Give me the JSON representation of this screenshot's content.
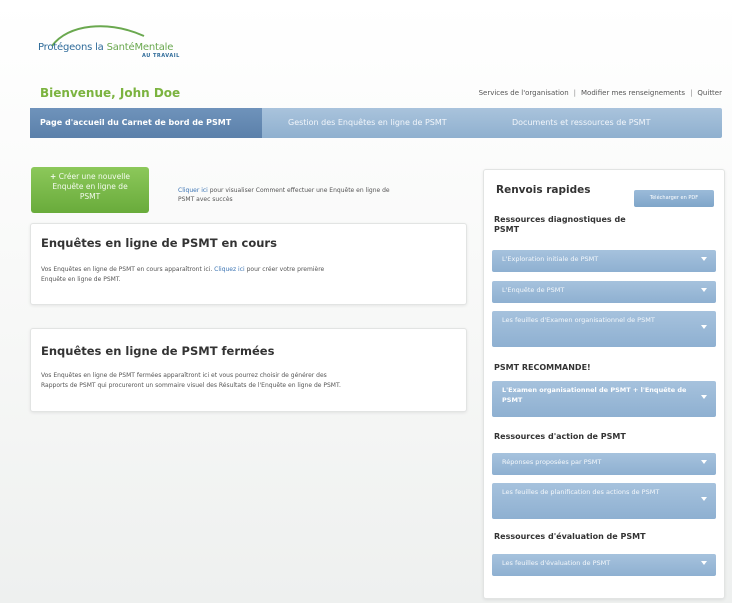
{
  "logo": {
    "part1": "Protégeons la ",
    "part2": "SantéMentale",
    "sub": "AU TRAVAIL"
  },
  "welcome": "Bienvenue, John Doe",
  "toplinks": [
    "Services de l'organisation",
    "Modifier mes renseignements",
    "Quitter"
  ],
  "nav": [
    {
      "label": "Page d'accueil du Carnet de bord de PSMT",
      "active": true
    },
    {
      "label": "Gestion des Enquêtes en ligne de PSMT",
      "active": false
    },
    {
      "label": "Documents et ressources de PSMT",
      "active": false
    }
  ],
  "create_button": {
    "plus": "+",
    "line1": "Créer une nouvelle",
    "line2": "Enquête en ligne de",
    "line3": "PSMT"
  },
  "help": {
    "link": "Cliquer ici",
    "text1": " pour visualiser Comment effectuer une Enquête en ligne de",
    "text2": "PSMT avec succès"
  },
  "panel_current": {
    "title": "Enquêtes en ligne de PSMT en cours",
    "text1": "Vos Enquêtes en ligne de PSMT en cours apparaîtront ici. ",
    "link": "Cliquez ici",
    "text2": " pour créer votre première",
    "text3": "Enquête en ligne de PSMT."
  },
  "panel_closed": {
    "title": "Enquêtes en ligne de PSMT fermées",
    "text1": "Vos Enquêtes en ligne de PSMT fermées apparaîtront ici et vous pourrez choisir de générer des",
    "text2": "Rapports de PSMT qui procureront un sommaire visuel des Résultats de l'Enquête en ligne de PSMT."
  },
  "sidebar": {
    "title": "Renvois rapides",
    "pdf_button": "Télécharger en PDF",
    "sections": [
      {
        "heading": "Ressources diagnostiques de PSMT",
        "items": [
          "L'Exploration initiale de PSMT",
          "L'Enquête de PSMT",
          "Les feuilles d'Examen organisationnel de PSMT"
        ]
      },
      {
        "heading": "PSMT RECOMMANDE!",
        "items": [
          "L'Examen organisationnel de PSMT + l'Enquête de PSMT"
        ]
      },
      {
        "heading": "Ressources d'action de PSMT",
        "items": [
          "Réponses proposées par PSMT",
          "Les feuilles de planification des actions de PSMT"
        ]
      },
      {
        "heading": "Ressources d'évaluation de PSMT",
        "items": [
          "Les feuilles d'évaluation de PSMT"
        ]
      }
    ]
  },
  "colors": {
    "accent_green": "#7bb33f",
    "nav_blue": "#8fb0cf",
    "nav_active": "#5b80aa",
    "button_green": "#69ab3b"
  }
}
